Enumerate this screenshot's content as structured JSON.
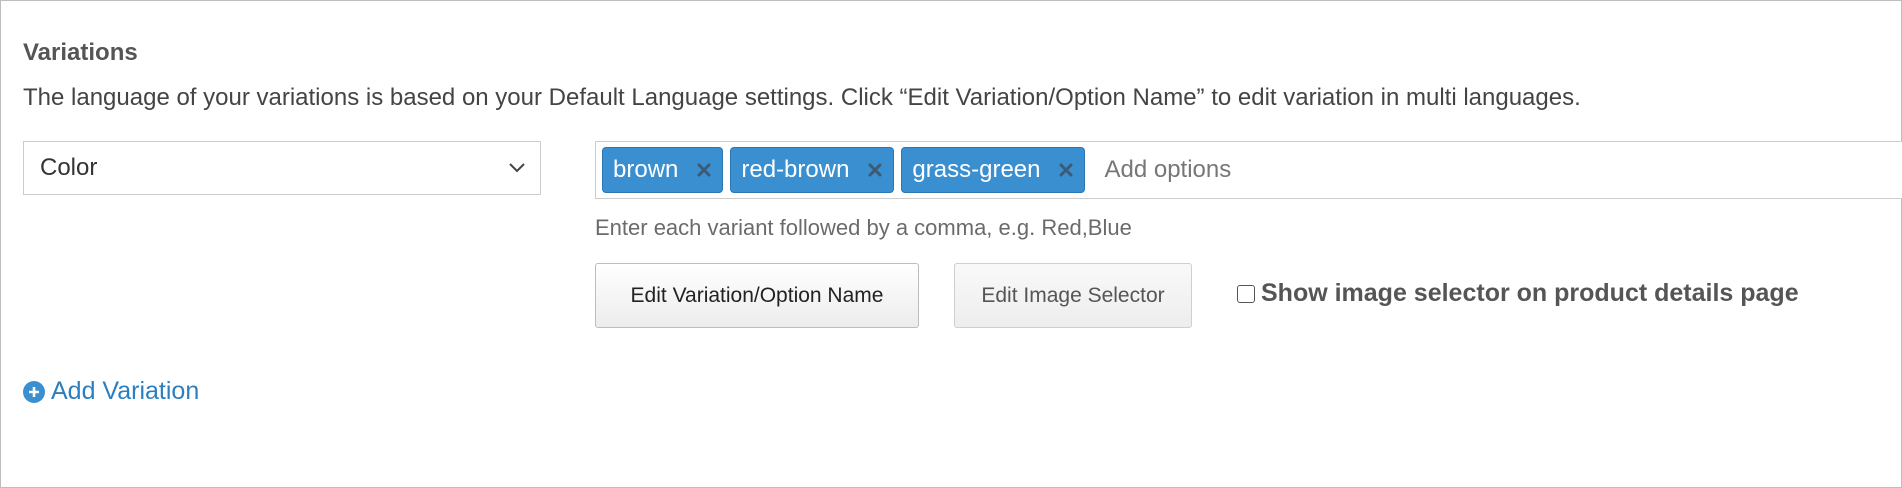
{
  "section": {
    "title": "Variations",
    "description": "The language of your variations is based on your Default Language settings. Click “Edit Variation/Option Name” to edit variation in multi languages."
  },
  "variation": {
    "type_select": {
      "value": "Color",
      "icon": "chevron-down-icon"
    },
    "options": [
      {
        "label": "brown"
      },
      {
        "label": "red-brown"
      },
      {
        "label": "grass-green"
      }
    ],
    "option_input_placeholder": "Add options",
    "help_text": "Enter each variant followed by a comma, e.g. Red,Blue"
  },
  "buttons": {
    "edit_name": "Edit Variation/Option Name",
    "edit_image": "Edit Image Selector"
  },
  "image_selector_checkbox": {
    "label": "Show image selector on product details page",
    "checked": false
  },
  "add_variation": {
    "label": "Add Variation",
    "icon": "plus-circle-icon"
  },
  "colors": {
    "tag_bg": "#3a8fd1",
    "link": "#2a7fc2",
    "border": "#cccccc"
  }
}
